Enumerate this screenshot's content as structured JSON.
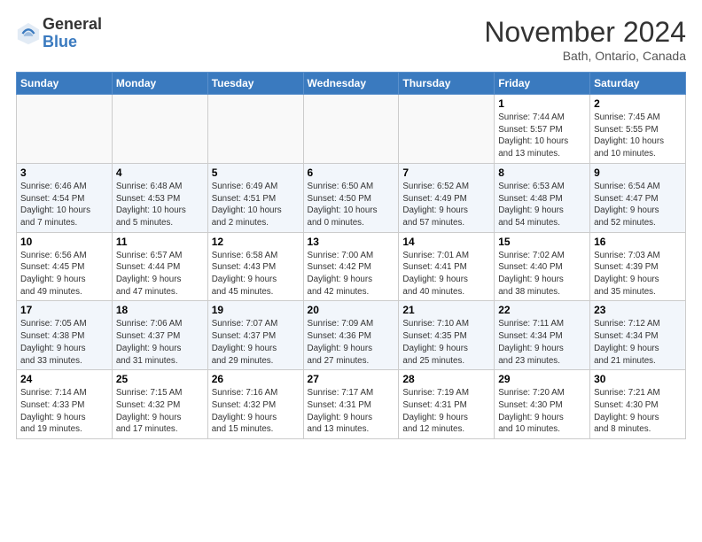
{
  "header": {
    "logo_general": "General",
    "logo_blue": "Blue",
    "month_title": "November 2024",
    "location": "Bath, Ontario, Canada"
  },
  "days_of_week": [
    "Sunday",
    "Monday",
    "Tuesday",
    "Wednesday",
    "Thursday",
    "Friday",
    "Saturday"
  ],
  "weeks": [
    [
      {
        "day": "",
        "info": ""
      },
      {
        "day": "",
        "info": ""
      },
      {
        "day": "",
        "info": ""
      },
      {
        "day": "",
        "info": ""
      },
      {
        "day": "",
        "info": ""
      },
      {
        "day": "1",
        "info": "Sunrise: 7:44 AM\nSunset: 5:57 PM\nDaylight: 10 hours\nand 13 minutes."
      },
      {
        "day": "2",
        "info": "Sunrise: 7:45 AM\nSunset: 5:55 PM\nDaylight: 10 hours\nand 10 minutes."
      }
    ],
    [
      {
        "day": "3",
        "info": "Sunrise: 6:46 AM\nSunset: 4:54 PM\nDaylight: 10 hours\nand 7 minutes."
      },
      {
        "day": "4",
        "info": "Sunrise: 6:48 AM\nSunset: 4:53 PM\nDaylight: 10 hours\nand 5 minutes."
      },
      {
        "day": "5",
        "info": "Sunrise: 6:49 AM\nSunset: 4:51 PM\nDaylight: 10 hours\nand 2 minutes."
      },
      {
        "day": "6",
        "info": "Sunrise: 6:50 AM\nSunset: 4:50 PM\nDaylight: 10 hours\nand 0 minutes."
      },
      {
        "day": "7",
        "info": "Sunrise: 6:52 AM\nSunset: 4:49 PM\nDaylight: 9 hours\nand 57 minutes."
      },
      {
        "day": "8",
        "info": "Sunrise: 6:53 AM\nSunset: 4:48 PM\nDaylight: 9 hours\nand 54 minutes."
      },
      {
        "day": "9",
        "info": "Sunrise: 6:54 AM\nSunset: 4:47 PM\nDaylight: 9 hours\nand 52 minutes."
      }
    ],
    [
      {
        "day": "10",
        "info": "Sunrise: 6:56 AM\nSunset: 4:45 PM\nDaylight: 9 hours\nand 49 minutes."
      },
      {
        "day": "11",
        "info": "Sunrise: 6:57 AM\nSunset: 4:44 PM\nDaylight: 9 hours\nand 47 minutes."
      },
      {
        "day": "12",
        "info": "Sunrise: 6:58 AM\nSunset: 4:43 PM\nDaylight: 9 hours\nand 45 minutes."
      },
      {
        "day": "13",
        "info": "Sunrise: 7:00 AM\nSunset: 4:42 PM\nDaylight: 9 hours\nand 42 minutes."
      },
      {
        "day": "14",
        "info": "Sunrise: 7:01 AM\nSunset: 4:41 PM\nDaylight: 9 hours\nand 40 minutes."
      },
      {
        "day": "15",
        "info": "Sunrise: 7:02 AM\nSunset: 4:40 PM\nDaylight: 9 hours\nand 38 minutes."
      },
      {
        "day": "16",
        "info": "Sunrise: 7:03 AM\nSunset: 4:39 PM\nDaylight: 9 hours\nand 35 minutes."
      }
    ],
    [
      {
        "day": "17",
        "info": "Sunrise: 7:05 AM\nSunset: 4:38 PM\nDaylight: 9 hours\nand 33 minutes."
      },
      {
        "day": "18",
        "info": "Sunrise: 7:06 AM\nSunset: 4:37 PM\nDaylight: 9 hours\nand 31 minutes."
      },
      {
        "day": "19",
        "info": "Sunrise: 7:07 AM\nSunset: 4:37 PM\nDaylight: 9 hours\nand 29 minutes."
      },
      {
        "day": "20",
        "info": "Sunrise: 7:09 AM\nSunset: 4:36 PM\nDaylight: 9 hours\nand 27 minutes."
      },
      {
        "day": "21",
        "info": "Sunrise: 7:10 AM\nSunset: 4:35 PM\nDaylight: 9 hours\nand 25 minutes."
      },
      {
        "day": "22",
        "info": "Sunrise: 7:11 AM\nSunset: 4:34 PM\nDaylight: 9 hours\nand 23 minutes."
      },
      {
        "day": "23",
        "info": "Sunrise: 7:12 AM\nSunset: 4:34 PM\nDaylight: 9 hours\nand 21 minutes."
      }
    ],
    [
      {
        "day": "24",
        "info": "Sunrise: 7:14 AM\nSunset: 4:33 PM\nDaylight: 9 hours\nand 19 minutes."
      },
      {
        "day": "25",
        "info": "Sunrise: 7:15 AM\nSunset: 4:32 PM\nDaylight: 9 hours\nand 17 minutes."
      },
      {
        "day": "26",
        "info": "Sunrise: 7:16 AM\nSunset: 4:32 PM\nDaylight: 9 hours\nand 15 minutes."
      },
      {
        "day": "27",
        "info": "Sunrise: 7:17 AM\nSunset: 4:31 PM\nDaylight: 9 hours\nand 13 minutes."
      },
      {
        "day": "28",
        "info": "Sunrise: 7:19 AM\nSunset: 4:31 PM\nDaylight: 9 hours\nand 12 minutes."
      },
      {
        "day": "29",
        "info": "Sunrise: 7:20 AM\nSunset: 4:30 PM\nDaylight: 9 hours\nand 10 minutes."
      },
      {
        "day": "30",
        "info": "Sunrise: 7:21 AM\nSunset: 4:30 PM\nDaylight: 9 hours\nand 8 minutes."
      }
    ]
  ]
}
